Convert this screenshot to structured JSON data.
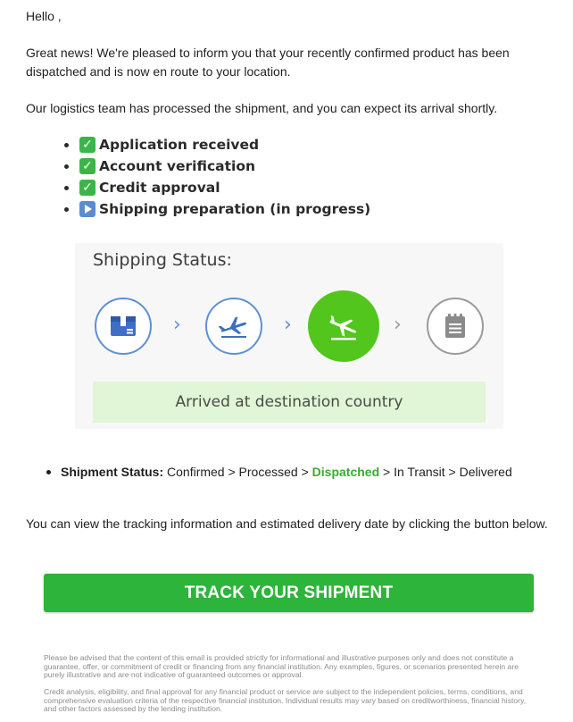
{
  "email": {
    "greeting": "Hello ,",
    "intro": "Great news! We're pleased to inform you that your recently confirmed product has been dispatched and is now en route to your location.",
    "logistics": "Our logistics team has processed the shipment, and you can expect its arrival shortly.",
    "checklist": [
      {
        "label": "Application received",
        "icon": "check-mark-button-icon",
        "icon_glyph": "✓"
      },
      {
        "label": "Account verification",
        "icon": "check-mark-button-icon",
        "icon_glyph": "✓"
      },
      {
        "label": "Credit approval",
        "icon": "check-mark-button-icon",
        "icon_glyph": "✓"
      },
      {
        "label": "Shipping preparation (in progress)",
        "icon": "play-button-icon",
        "icon_glyph": "▶"
      }
    ],
    "status_card": {
      "title": "Shipping Status:",
      "steps": [
        {
          "icon": "package-icon",
          "state": "done"
        },
        {
          "icon": "airplane-departing-icon",
          "state": "done"
        },
        {
          "icon": "airplane-landing-icon",
          "state": "current"
        },
        {
          "icon": "notepad-icon",
          "state": "pending"
        }
      ],
      "arrow_glyph": "›",
      "arrival_text": "Arrived at destination country"
    },
    "shipment_status": {
      "label": "Shipment Status:",
      "before": " Confirmed > Processed > ",
      "current": "Dispatched",
      "after": " > In Transit > Delivered"
    },
    "tracking_text": "You can view the tracking information and estimated delivery date by clicking the button below.",
    "track_button": "TRACK YOUR SHIPMENT",
    "disclaimer_1": "Please be advised that the content of this email is provided strictly for informational and illustrative purposes only and does not constitute a guarantee, offer, or commitment of credit or financing from any financial institution. Any examples, figures, or scenarios presented herein are purely illustrative and are not indicative of guaranteed outcomes or approval.",
    "disclaimer_2": "Credit analysis, eligibility, and final approval for any financial product or service are subject to the independent policies, terms, conditions, and comprehensive evaluation criteria of the respective financial institution. Individual results may vary based on creditworthiness, financial history, and other factors assessed by the lending institution."
  },
  "colors": {
    "accent_green": "#2db43a",
    "active_step": "#52c61c",
    "step_blue": "#5f8fd6",
    "arrival_bg": "#e0f6d6",
    "dispatched_text": "#3aa935"
  }
}
